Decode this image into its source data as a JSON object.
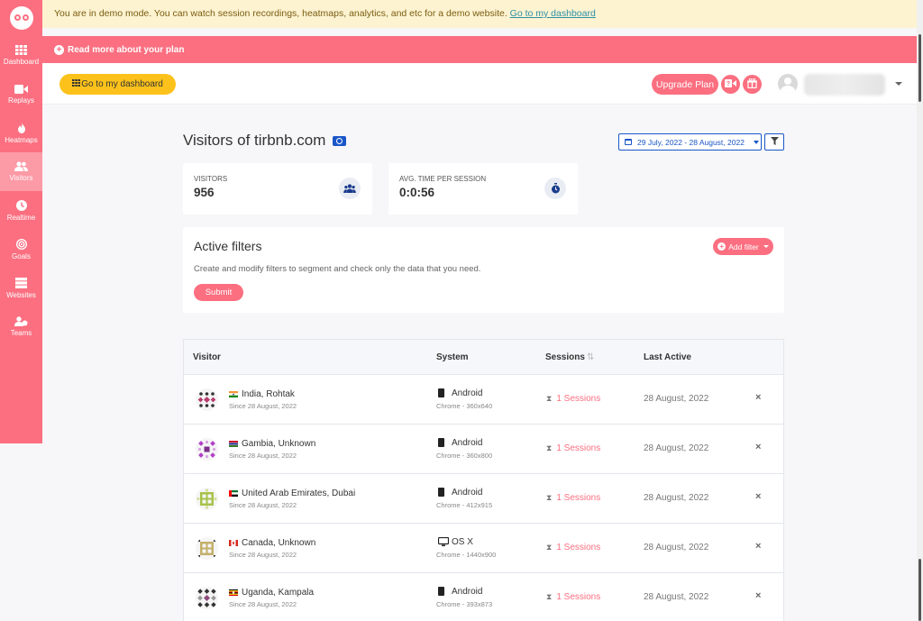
{
  "demo_banner": {
    "text": "You are in demo mode. You can watch session recordings, heatmaps, analytics, and etc for a demo website.",
    "link": "Go to my dashboard"
  },
  "plan_banner": {
    "text": "Read more about your plan"
  },
  "topbar": {
    "dashboard_button": "Go to my dashboard",
    "upgrade_button": "Upgrade Plan"
  },
  "sidebar": {
    "items": [
      {
        "label": "Dashboard",
        "icon": "grid-icon"
      },
      {
        "label": "Replays",
        "icon": "video-icon"
      },
      {
        "label": "Heatmaps",
        "icon": "flame-icon"
      },
      {
        "label": "Visitors",
        "icon": "users-icon",
        "active": true
      },
      {
        "label": "Realtime",
        "icon": "clock-icon"
      },
      {
        "label": "Goals",
        "icon": "target-icon"
      },
      {
        "label": "Websites",
        "icon": "server-icon"
      },
      {
        "label": "Teams",
        "icon": "team-icon"
      }
    ]
  },
  "page": {
    "title": "Visitors of tirbnb.com",
    "date_range": "29 July, 2022 - 28 August, 2022"
  },
  "stats": {
    "visitors_label": "VISITORS",
    "visitors_value": "956",
    "avg_time_label": "AVG. TIME PER SESSION",
    "avg_time_value": "0:0:56"
  },
  "filters": {
    "title": "Active filters",
    "description": "Create and modify filters to segment and check only the data that you need.",
    "add_filter": "Add filter",
    "submit": "Submit"
  },
  "table": {
    "headers": {
      "visitor": "Visitor",
      "system": "System",
      "sessions": "Sessions",
      "last_active": "Last Active"
    },
    "rows": [
      {
        "location": "India, Rohtak",
        "since": "Since 28 August, 2022",
        "os": "Android",
        "browser": "Chrome - 360x640",
        "sessions": "1 Sessions",
        "last_active": "28 August, 2022"
      },
      {
        "location": "Gambia, Unknown",
        "since": "Since 28 August, 2022",
        "os": "Android",
        "browser": "Chrome - 360x800",
        "sessions": "1 Sessions",
        "last_active": "28 August, 2022"
      },
      {
        "location": "United Arab Emirates, Dubai",
        "since": "Since 28 August, 2022",
        "os": "Android",
        "browser": "Chrome - 412x915",
        "sessions": "1 Sessions",
        "last_active": "28 August, 2022"
      },
      {
        "location": "Canada, Unknown",
        "since": "Since 28 August, 2022",
        "os": "OS X",
        "browser": "Chrome - 1440x900",
        "sessions": "1 Sessions",
        "last_active": "28 August, 2022"
      },
      {
        "location": "Uganda, Kampala",
        "since": "Since 28 August, 2022",
        "os": "Android",
        "browser": "Chrome - 393x873",
        "sessions": "1 Sessions",
        "last_active": "28 August, 2022"
      }
    ]
  },
  "colors": {
    "brand": "#fb6f80",
    "accent_blue": "#1a56c8",
    "yellow": "#fcc21b"
  }
}
